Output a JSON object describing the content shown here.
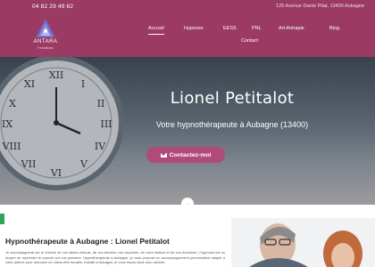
{
  "topbar": {
    "phone": "04 82 29 49 62",
    "address": "125 Avenue Dante Pilat, 13400 Aubagne"
  },
  "logo": {
    "brand": "ANTARA",
    "tagline": "Formations"
  },
  "nav": {
    "items": [
      {
        "label": "Accueil",
        "active": true
      },
      {
        "label": "Hypnose"
      },
      {
        "label": "EESS"
      },
      {
        "label": "PNL"
      },
      {
        "label": "Art-thérapie"
      },
      {
        "label": "Blog"
      },
      {
        "label": "Contact"
      }
    ]
  },
  "hero": {
    "title": "Lionel Petitalot",
    "subtitle": "Votre hypnothérapeute à Aubagne (13400)",
    "cta_label": "Contactez-moi"
  },
  "content": {
    "heading": "Hypnothérapeute à Aubagne : Lionel Petitalot",
    "paragraph": "Je accompagnerai sur le chemin de vos désirs enfouis, de vos besoins non exprimés, de votre instinct et de vos émotions. L'hypnose est un moyen de reprendre le pouvoir sur vos pensées. Hypnothérapeute à Aubagne, je vous propose un accompagnement personnalisé adapté à votre rythme pour retrouver un mieux-être durable. Installé à Aubagne, je vous reçois dans mon cabinet."
  },
  "colors": {
    "brand": "#9b3a63",
    "accent": "#b04a78",
    "side_tab": "#2fa45b"
  }
}
